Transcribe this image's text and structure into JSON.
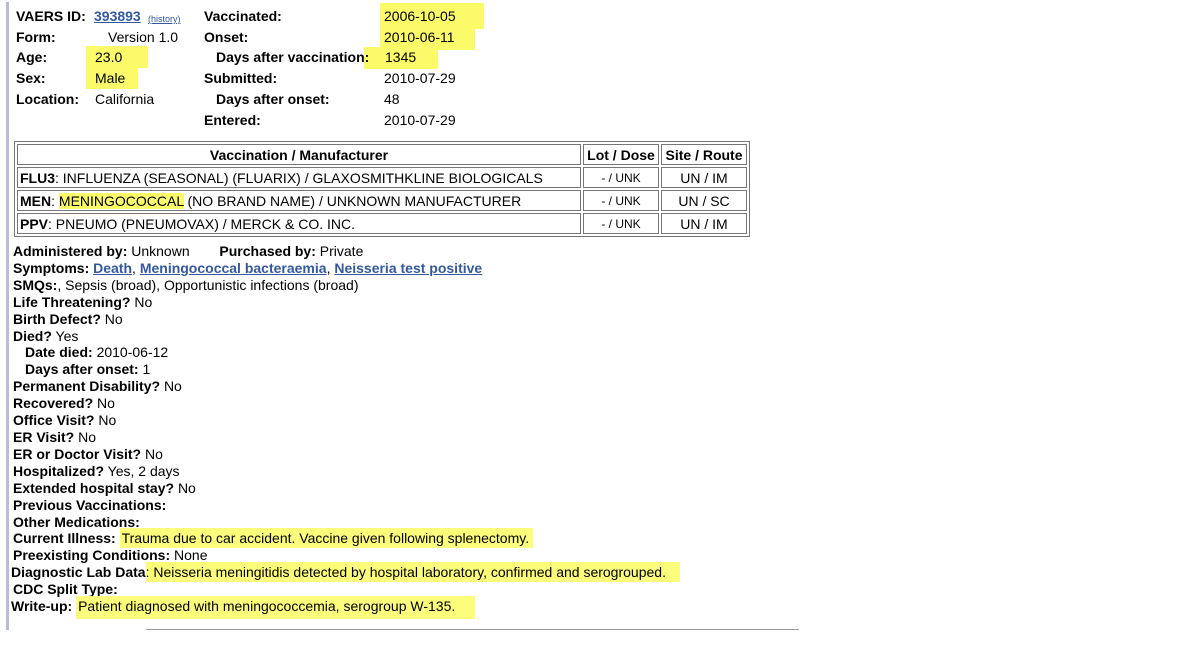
{
  "header": {
    "vaers_id_label": "VAERS ID:",
    "vaers_id": "393893",
    "history_link": "(history)",
    "form_label": "Form:",
    "form": "Version 1.0",
    "age_label": "Age:",
    "age": "23.0",
    "sex_label": "Sex:",
    "sex": "Male",
    "location_label": "Location:",
    "location": "California",
    "vaccinated_label": "Vaccinated:",
    "vaccinated": "2006-10-05",
    "onset_label": "Onset:",
    "onset": "2010-06-11",
    "days_after_vax_label": "Days after vaccination:",
    "days_after_vax": "1345",
    "submitted_label": "Submitted:",
    "submitted": "2010-07-29",
    "days_after_onset_label": "Days after onset:",
    "days_after_onset": "48",
    "entered_label": "Entered:",
    "entered": "2010-07-29"
  },
  "vax_table": {
    "headers": [
      "Vaccination / Manufacturer",
      "Lot / Dose",
      "Site / Route"
    ],
    "rows": [
      {
        "code": "FLU3",
        "desc": ": INFLUENZA (SEASONAL) (FLUARIX) / GLAXOSMITHKLINE BIOLOGICALS",
        "lot": "- / UNK",
        "site": "UN / IM"
      },
      {
        "code": "MEN",
        "desc_pre": ": ",
        "desc_hl": "MENINGOCOCCAL",
        "desc": " (NO BRAND NAME) / UNKNOWN MANUFACTURER",
        "lot": "- / UNK",
        "site": "UN / SC"
      },
      {
        "code": "PPV",
        "desc": ": PNEUMO (PNEUMOVAX) / MERCK & CO. INC.",
        "lot": "- / UNK",
        "site": "UN / IM"
      }
    ]
  },
  "details": {
    "administered_label": "Administered by:",
    "administered": "Unknown",
    "purchased_label": "Purchased by:",
    "purchased": "Private",
    "symptoms_label": "Symptoms:",
    "symptoms": [
      "Death",
      "Meningococcal bacteraemia",
      "Neisseria test positive"
    ],
    "smqs_label": "SMQs:",
    "smqs": ", Sepsis (broad), Opportunistic infections (broad)",
    "life_threatening_label": "Life Threatening?",
    "life_threatening": "No",
    "birth_defect_label": "Birth Defect?",
    "birth_defect": "No",
    "died_label": "Died?",
    "died": "Yes",
    "date_died_label": "Date died:",
    "date_died": "2010-06-12",
    "days_after_onset_label": "Days after onset:",
    "days_after_onset": "1",
    "permanent_disability_label": "Permanent Disability?",
    "permanent_disability": "No",
    "recovered_label": "Recovered?",
    "recovered": "No",
    "office_visit_label": "Office Visit?",
    "office_visit": "No",
    "er_visit_label": "ER Visit?",
    "er_visit": "No",
    "er_doctor_label": "ER or Doctor Visit?",
    "er_doctor": "No",
    "hospitalized_label": "Hospitalized?",
    "hospitalized": "Yes, 2 days",
    "extended_stay_label": "Extended hospital stay?",
    "extended_stay": "No",
    "previous_vax_label": "Previous Vaccinations:",
    "other_meds_label": "Other Medications:",
    "current_illness_label": "Current Illness:",
    "current_illness": "Trauma due to car accident. Vaccine given following splenectomy.",
    "preexisting_label": "Preexisting Conditions:",
    "preexisting": "None",
    "diagnostic_label": "Diagnostic Lab Data",
    "diagnostic": ": Neisseria meningitidis detected by hospital laboratory, confirmed and serogrouped.",
    "cdc_split_label": "CDC Split Type:",
    "writeup_label": "Write-up:",
    "writeup": "Patient diagnosed with meningococcemia, serogroup W-135."
  }
}
